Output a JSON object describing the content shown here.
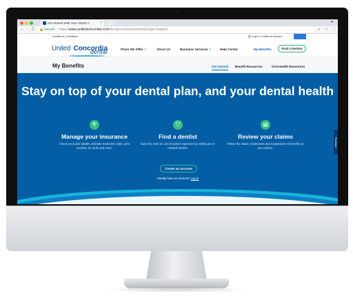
{
  "browser": {
    "tab_title": "Get Started With Your United C",
    "close_glyph": "×",
    "address": {
      "secure_label": "Secure",
      "scheme": "https://",
      "host": "www.unitedconcordia.com",
      "path": "/dental-insurance/member/get-started/"
    },
    "controls": {
      "back": "←",
      "forward": "→",
      "reload": "C"
    },
    "icons": [
      "lock-icon",
      "search-icon",
      "star-icon",
      "menu-icon",
      "profile-icon"
    ]
  },
  "site": {
    "util_left": "Contact Us | Feedback",
    "util_right": "Log In / Create an Account",
    "logo": {
      "united": "United",
      "concordia": "Concordia",
      "dental": "dental"
    },
    "nav": [
      {
        "label": "Plans We Offer",
        "dropdown": true
      },
      {
        "label": "About Us",
        "dropdown": false
      },
      {
        "label": "Business Services",
        "dropdown": true
      },
      {
        "label": "Help Center",
        "dropdown": false
      },
      {
        "label": "My Benefits",
        "dropdown": false
      }
    ],
    "find_dentist_button": "Find a Dentist",
    "page_title": "My Benefits",
    "subnav": [
      "Get Started",
      "Benefit Resources",
      "Oral Health Resources"
    ],
    "hero": {
      "heading": "Stay on top of your dental plan, and your dental health",
      "columns": [
        {
          "icon": "shield-icon",
          "title": "Manage your insurance",
          "text": "Check your plan details, estimate treatment costs, print member ID cards and more."
        },
        {
          "icon": "tooth-icon",
          "title": "Find a dentist",
          "text": "Save the most on out-of-pocket expenses by visiting an in-network dentist."
        },
        {
          "icon": "document-icon",
          "title": "Review your claims",
          "text": "Follow the status, statements and explanation of benefits on your claims."
        }
      ],
      "cta": "Create an account",
      "have_account": "Already have an account?",
      "login_link": "Log in",
      "feedback_tab": "Feedback"
    }
  },
  "colors": {
    "brand_blue": "#035ea5",
    "accent_green": "#34bf82",
    "link_blue": "#0a62c5"
  }
}
